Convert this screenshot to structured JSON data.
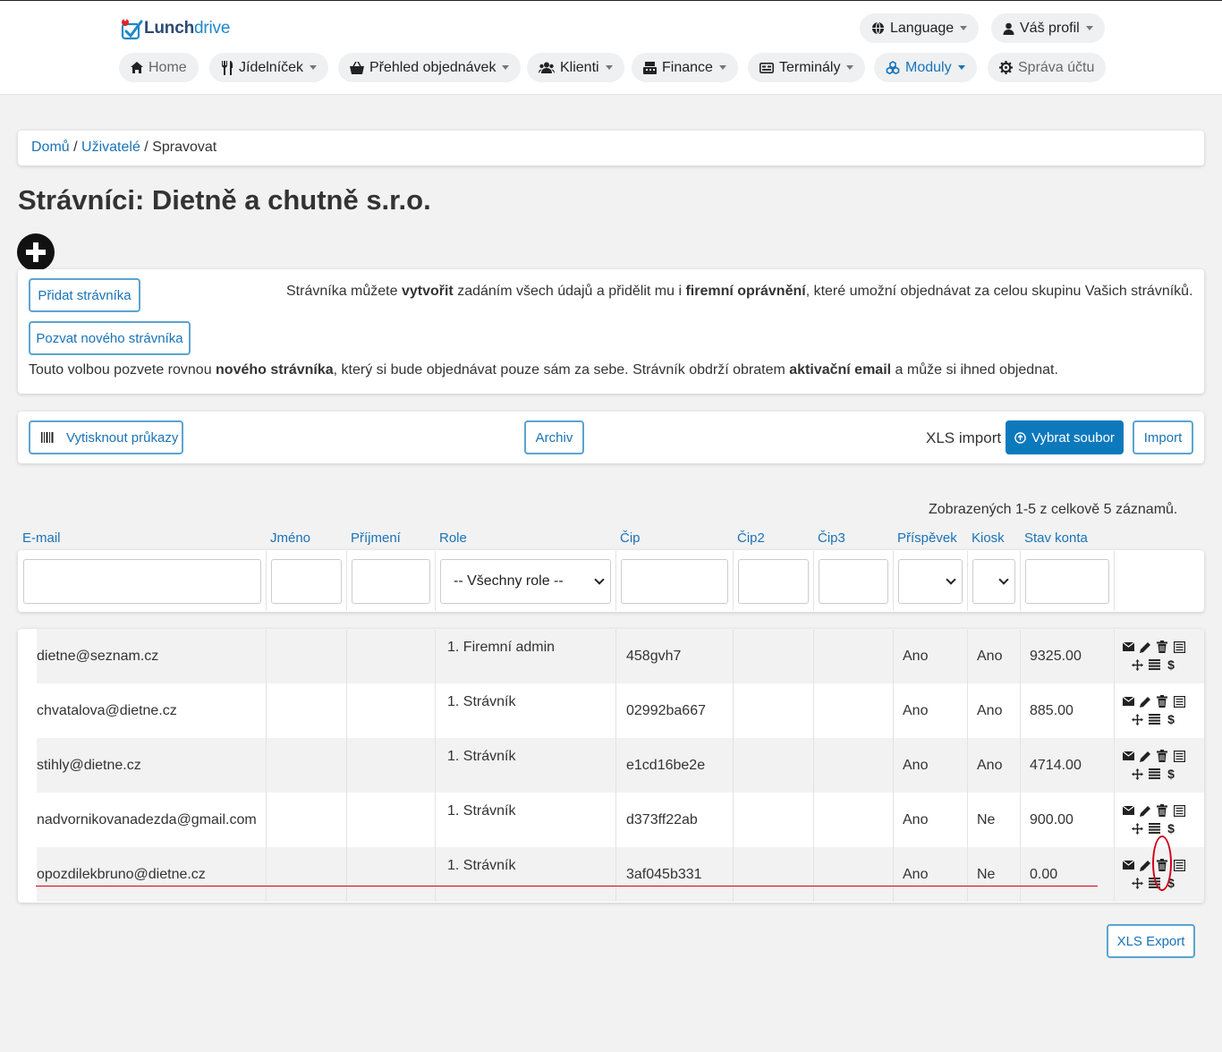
{
  "header": {
    "logo_text_bold": "Lunch",
    "logo_text_light": "drive",
    "language": "Language",
    "profile": "Váš profil",
    "nav": [
      {
        "label": "Home",
        "icon": "home-icon"
      },
      {
        "label": "Jídelníček",
        "icon": "fork-knife-icon"
      },
      {
        "label": "Přehled objednávek",
        "icon": "basket-icon"
      },
      {
        "label": "Klienti",
        "icon": "users-icon"
      },
      {
        "label": "Finance",
        "icon": "cash-register-icon"
      },
      {
        "label": "Terminály",
        "icon": "terminal-icon"
      },
      {
        "label": "Moduly",
        "icon": "modules-icon"
      },
      {
        "label": "Správa účtu",
        "icon": "gear-icon"
      }
    ]
  },
  "breadcrumb": {
    "home": "Domů",
    "sep": "/",
    "users": "Uživatelé",
    "current": "Spravovat"
  },
  "page_title": "Strávníci: Dietně a chutně s.r.o.",
  "add_section": {
    "add_button": "Přidat strávníka",
    "invite_button": "Pozvat nového strávníka",
    "info1": [
      "Strávníka můžete ",
      "vytvořit",
      " zadáním všech údajů a přidělit mu i ",
      "firemní oprávnění",
      ", které umožní objednávat za celou skupinu Vašich strávníků."
    ],
    "info2": [
      "Touto volbou pozvete rovnou ",
      "nového strávníka",
      ", který si bude objednávat pouze sám za sebe. Strávník obdrží obratem ",
      "aktivační email",
      " a může si ihned objednat."
    ]
  },
  "toolbar": {
    "print_cards": "Vytisknout průkazy",
    "archive": "Archiv",
    "xls_import_label": "XLS import",
    "choose_file": "Vybrat soubor",
    "import": "Import"
  },
  "summary": "Zobrazených 1-5 z celkově 5 záznamů.",
  "columns": [
    "E-mail",
    "Jméno",
    "Příjmení",
    "Role",
    "Čip",
    "Čip2",
    "Čip3",
    "Příspěvek",
    "Kiosk",
    "Stav konta"
  ],
  "filters": {
    "role": "-- Všechny role --",
    "contribution": "",
    "kiosk": ""
  },
  "rows": [
    {
      "email": "dietne@seznam.cz",
      "first": "",
      "last": "",
      "role": "1. Firemní admin",
      "chip": "458gvh7",
      "chip2": "",
      "chip3": "",
      "contribution": "Ano",
      "kiosk": "Ano",
      "balance": "9325.00"
    },
    {
      "email": "chvatalova@dietne.cz",
      "first": "",
      "last": "",
      "role": "1. Strávník",
      "chip": "02992ba667",
      "chip2": "",
      "chip3": "",
      "contribution": "Ano",
      "kiosk": "Ano",
      "balance": "885.00"
    },
    {
      "email": "stihly@dietne.cz",
      "first": "",
      "last": "",
      "role": "1. Strávník",
      "chip": "e1cd16be2e",
      "chip2": "",
      "chip3": "",
      "contribution": "Ano",
      "kiosk": "Ano",
      "balance": "4714.00"
    },
    {
      "email": "nadvornikovanadezda@gmail.com",
      "first": "",
      "last": "",
      "role": "1. Strávník",
      "chip": "d373ff22ab",
      "chip2": "",
      "chip3": "",
      "contribution": "Ano",
      "kiosk": "Ne",
      "balance": "900.00"
    },
    {
      "email": "opozdilekbruno@dietne.cz",
      "first": "",
      "last": "",
      "role": "1. Strávník",
      "chip": "3af045b331",
      "chip2": "",
      "chip3": "",
      "contribution": "Ano",
      "kiosk": "Ne",
      "balance": "0.00"
    }
  ],
  "row_actions": {
    "dollar": "$"
  },
  "export": "XLS Export",
  "annotation_color": "#d0021b",
  "accent_color": "#1a73b8"
}
